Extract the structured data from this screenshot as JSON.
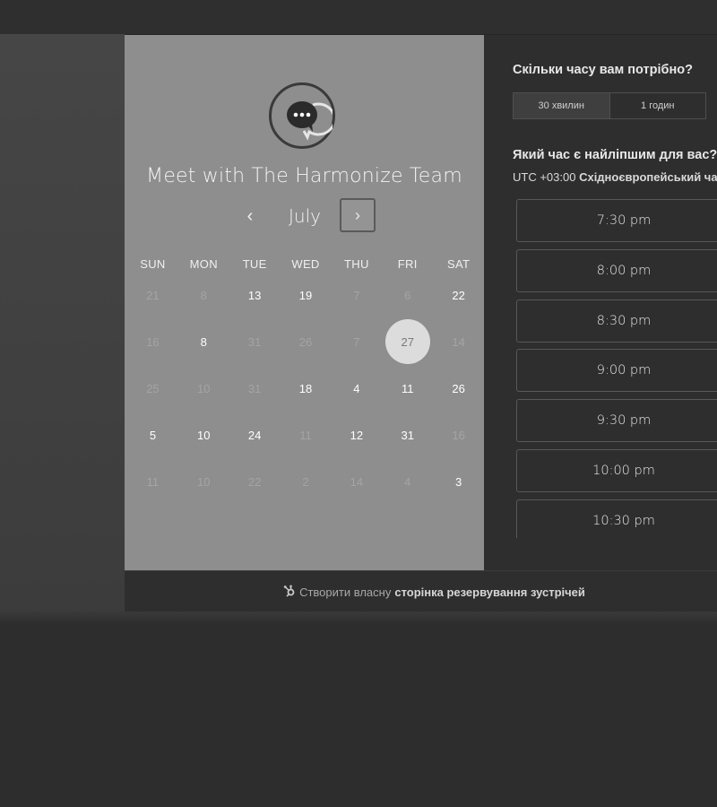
{
  "left_panel": {
    "title": "Meet with The Harmonize Team",
    "month": "July",
    "prev_arrow": "‹",
    "next_arrow": "›",
    "weekdays": [
      "SUN",
      "MON",
      "TUE",
      "WED",
      "THU",
      "FRI",
      "SAT"
    ],
    "weeks": [
      [
        {
          "d": "21",
          "a": false
        },
        {
          "d": "8",
          "a": false
        },
        {
          "d": "13",
          "a": true
        },
        {
          "d": "19",
          "a": true
        },
        {
          "d": "7",
          "a": false
        },
        {
          "d": "6",
          "a": false
        },
        {
          "d": "22",
          "a": true
        }
      ],
      [
        {
          "d": "16",
          "a": false
        },
        {
          "d": "8",
          "a": true
        },
        {
          "d": "31",
          "a": false
        },
        {
          "d": "26",
          "a": false
        },
        {
          "d": "7",
          "a": false
        },
        {
          "d": "27",
          "a": true,
          "selected": true
        },
        {
          "d": "14",
          "a": false
        }
      ],
      [
        {
          "d": "25",
          "a": false
        },
        {
          "d": "10",
          "a": false
        },
        {
          "d": "31",
          "a": false
        },
        {
          "d": "18",
          "a": true
        },
        {
          "d": "4",
          "a": true
        },
        {
          "d": "11",
          "a": true
        },
        {
          "d": "26",
          "a": true
        }
      ],
      [
        {
          "d": "5",
          "a": true
        },
        {
          "d": "10",
          "a": true
        },
        {
          "d": "24",
          "a": true
        },
        {
          "d": "11",
          "a": false
        },
        {
          "d": "12",
          "a": true
        },
        {
          "d": "31",
          "a": true
        },
        {
          "d": "16",
          "a": false
        }
      ],
      [
        {
          "d": "11",
          "a": false
        },
        {
          "d": "10",
          "a": false
        },
        {
          "d": "22",
          "a": false
        },
        {
          "d": "2",
          "a": false
        },
        {
          "d": "14",
          "a": false
        },
        {
          "d": "4",
          "a": false
        },
        {
          "d": "3",
          "a": true
        }
      ]
    ]
  },
  "right_panel": {
    "duration_question": "Скільки часу вам потрібно?",
    "durations": [
      "30 хвилин",
      "1 годин"
    ],
    "time_question": "Який час є найліпшим для вас?",
    "timezone_offset": "UTC +03:00",
    "timezone_name": "Східноєвропейський час",
    "slots": [
      "7:30 pm",
      "8:00 pm",
      "8:30 pm",
      "9:00 pm",
      "9:30 pm",
      "10:00 pm",
      "10:30 pm"
    ]
  },
  "footer": {
    "prefix": "Створити власну",
    "link": "сторінка резервування зустрічей"
  }
}
